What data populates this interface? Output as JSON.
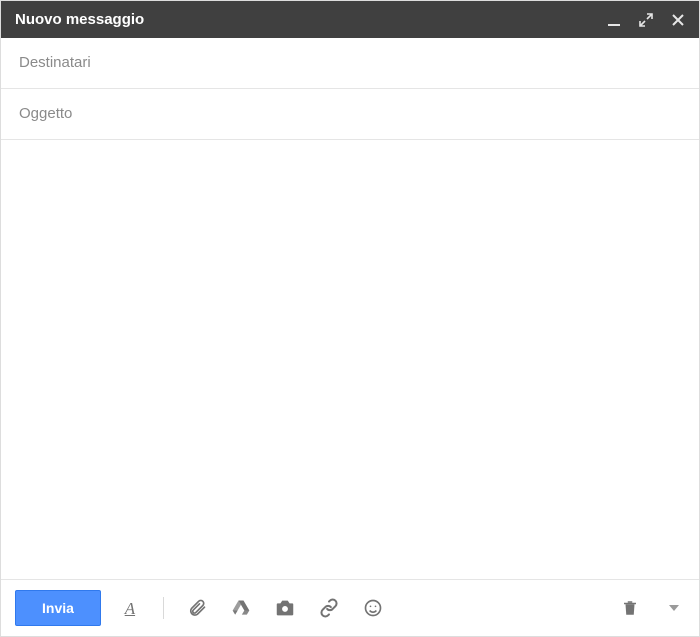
{
  "header": {
    "title": "Nuovo messaggio"
  },
  "fields": {
    "recipients_placeholder": "Destinatari",
    "recipients_value": "",
    "subject_placeholder": "Oggetto",
    "subject_value": "",
    "body_value": ""
  },
  "toolbar": {
    "send_label": "Invia",
    "format_label": "A"
  },
  "icons": {
    "minimize": "minimize",
    "expand": "expand",
    "close": "close",
    "format": "format-text",
    "attach": "paperclip",
    "drive": "drive",
    "photo": "camera",
    "link": "link",
    "emoji": "emoji",
    "trash": "trash",
    "more": "caret-down"
  }
}
